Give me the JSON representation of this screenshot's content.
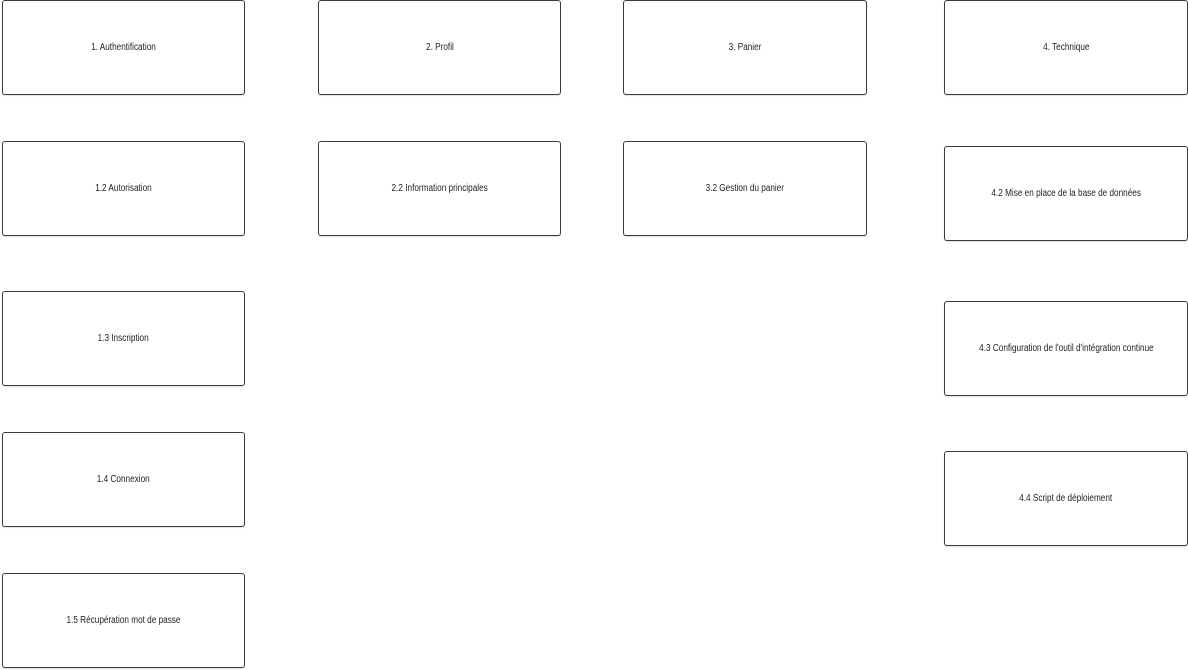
{
  "diagram": {
    "columns": [
      {
        "nodes": [
          {
            "label": "1. Authentification"
          },
          {
            "label": "1.2 Autorisation"
          },
          {
            "label": "1.3 Inscription"
          },
          {
            "label": "1.4 Connexion"
          },
          {
            "label": "1.5 Récupération mot de passe"
          }
        ]
      },
      {
        "nodes": [
          {
            "label": "2. Profil"
          },
          {
            "label": "2.2 Information principales"
          }
        ]
      },
      {
        "nodes": [
          {
            "label": "3. Panier"
          },
          {
            "label": "3.2 Gestion du panier"
          }
        ]
      },
      {
        "nodes": [
          {
            "label": "4. Technique"
          },
          {
            "label": "4.2 Mise en place de la base de données"
          },
          {
            "label": "4.3 Configuration de l'outil d'intégration continue"
          },
          {
            "label": "4.4 Script de déploiement"
          }
        ]
      }
    ]
  },
  "colors": {
    "background": "#ffffff",
    "node_border": "#3a3a3a",
    "node_fill": "#ffffff",
    "text": "#222222"
  }
}
